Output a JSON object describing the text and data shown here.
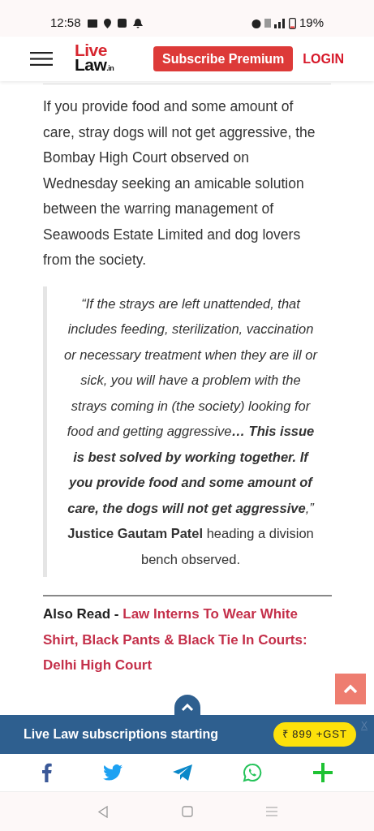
{
  "status_bar": {
    "time": "12:58",
    "battery": "19%"
  },
  "header": {
    "logo_top": "Live",
    "logo_bottom": "Law",
    "logo_suffix": ".in",
    "subscribe": "Subscribe Premium",
    "login": "LOGIN"
  },
  "article": {
    "paragraph": "If you provide food and some amount of care, stray dogs will not get aggressive, the Bombay High Court observed on Wednesday seeking an amicable solution between the warring management of Seawoods Estate Limited and dog lovers from the society.",
    "quote": [
      {
        "kind": "quote",
        "text": "“If the strays are left unattended, that includes feeding, sterilization, vaccination or necessary treatment when they are ill or sick, you will have a problem with the strays coming in (the society) looking for food and getting aggressive**… This issue is best solved by working together. If you provide food and some amount of care, the dogs will not get aggressive**,”"
      },
      {
        "kind": "attribution",
        "text": "**Justice Gautam Patel** heading a division bench observed."
      }
    ],
    "also_read": {
      "label": "Also Read - ",
      "link": "Law Interns To Wear White Shirt, Black Pants & Black Tie In Courts: Delhi High Court"
    }
  },
  "banner": {
    "text": "Live Law subscriptions starting",
    "price": "₹ 899 +GST",
    "close": "X"
  }
}
